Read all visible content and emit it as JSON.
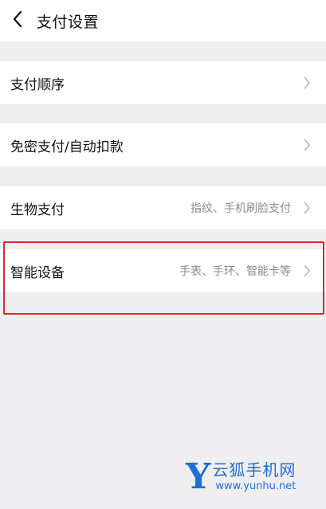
{
  "header": {
    "title": "支付设置",
    "back_icon": "chevron-left-icon"
  },
  "rows": [
    {
      "label": "支付顺序",
      "desc": ""
    },
    {
      "label": "免密支付/自动扣款",
      "desc": ""
    },
    {
      "label": "生物支付",
      "desc": "指纹、手机刷脸支付"
    },
    {
      "label": "智能设备",
      "desc": "手表、手环、智能卡等"
    }
  ],
  "highlight_color": "#e5252a",
  "watermark": {
    "logo": "Y",
    "name": "云狐手机网",
    "url": "www.yunhu.net",
    "color": "#1f6fd6"
  }
}
